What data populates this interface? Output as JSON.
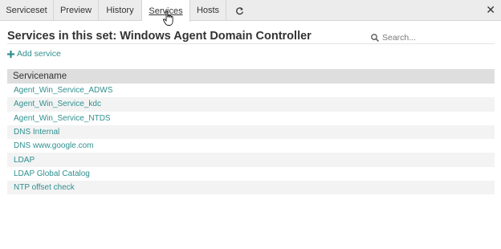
{
  "tabs": [
    {
      "label": "Serviceset"
    },
    {
      "label": "Preview"
    },
    {
      "label": "History"
    },
    {
      "label": "Services"
    },
    {
      "label": "Hosts"
    }
  ],
  "active_tab": "Services",
  "icons": {
    "refresh": "refresh-icon",
    "close": "close-icon",
    "search": "search-icon",
    "add": "plus-icon",
    "cursor": "hand-cursor-icon"
  },
  "colors": {
    "accent": "#2f8f8f",
    "tabbar": "#ececec",
    "header_row": "#dedede",
    "stripe": "#f3f3f3"
  },
  "page": {
    "title": "Services in this set: Windows Agent Domain Controller",
    "search_placeholder": "Search...",
    "add_label": "Add service"
  },
  "table": {
    "header": "Servicename",
    "rows": [
      "Agent_Win_Service_ADWS",
      "Agent_Win_Service_kdc",
      "Agent_Win_Service_NTDS",
      "DNS Internal",
      "DNS www.google.com",
      "LDAP",
      "LDAP Global Catalog",
      "NTP offset check"
    ]
  }
}
